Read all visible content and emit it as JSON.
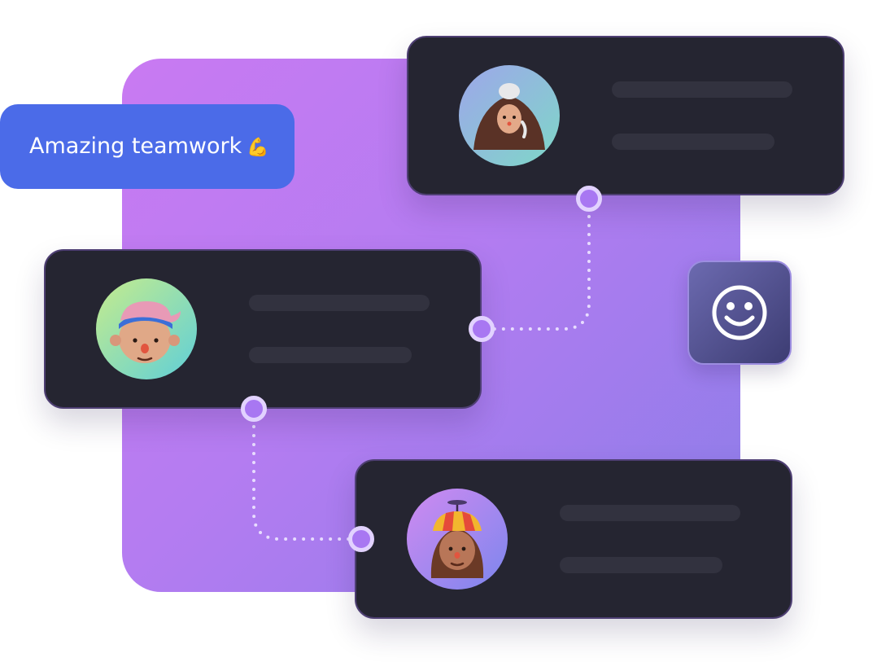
{
  "badge": {
    "text": "Amazing teamwork",
    "emoji": "💪"
  },
  "cards": [
    {
      "id": "top",
      "avatar": "woman-with-bun-avatar"
    },
    {
      "id": "middle",
      "avatar": "boy-with-pink-cap-avatar"
    },
    {
      "id": "bottom",
      "avatar": "girl-with-propeller-hat-avatar"
    }
  ],
  "icons": {
    "smiley": "smiley-face-icon"
  },
  "colors": {
    "background_gradient_start": "#c97af2",
    "background_gradient_end": "#8b7de8",
    "card": "#252531",
    "card_border": "#4e3f73",
    "placeholder_bar": "#32323f",
    "badge": "#4b6be8",
    "node": "#a877f2",
    "node_ring": "#e2d2ff"
  }
}
